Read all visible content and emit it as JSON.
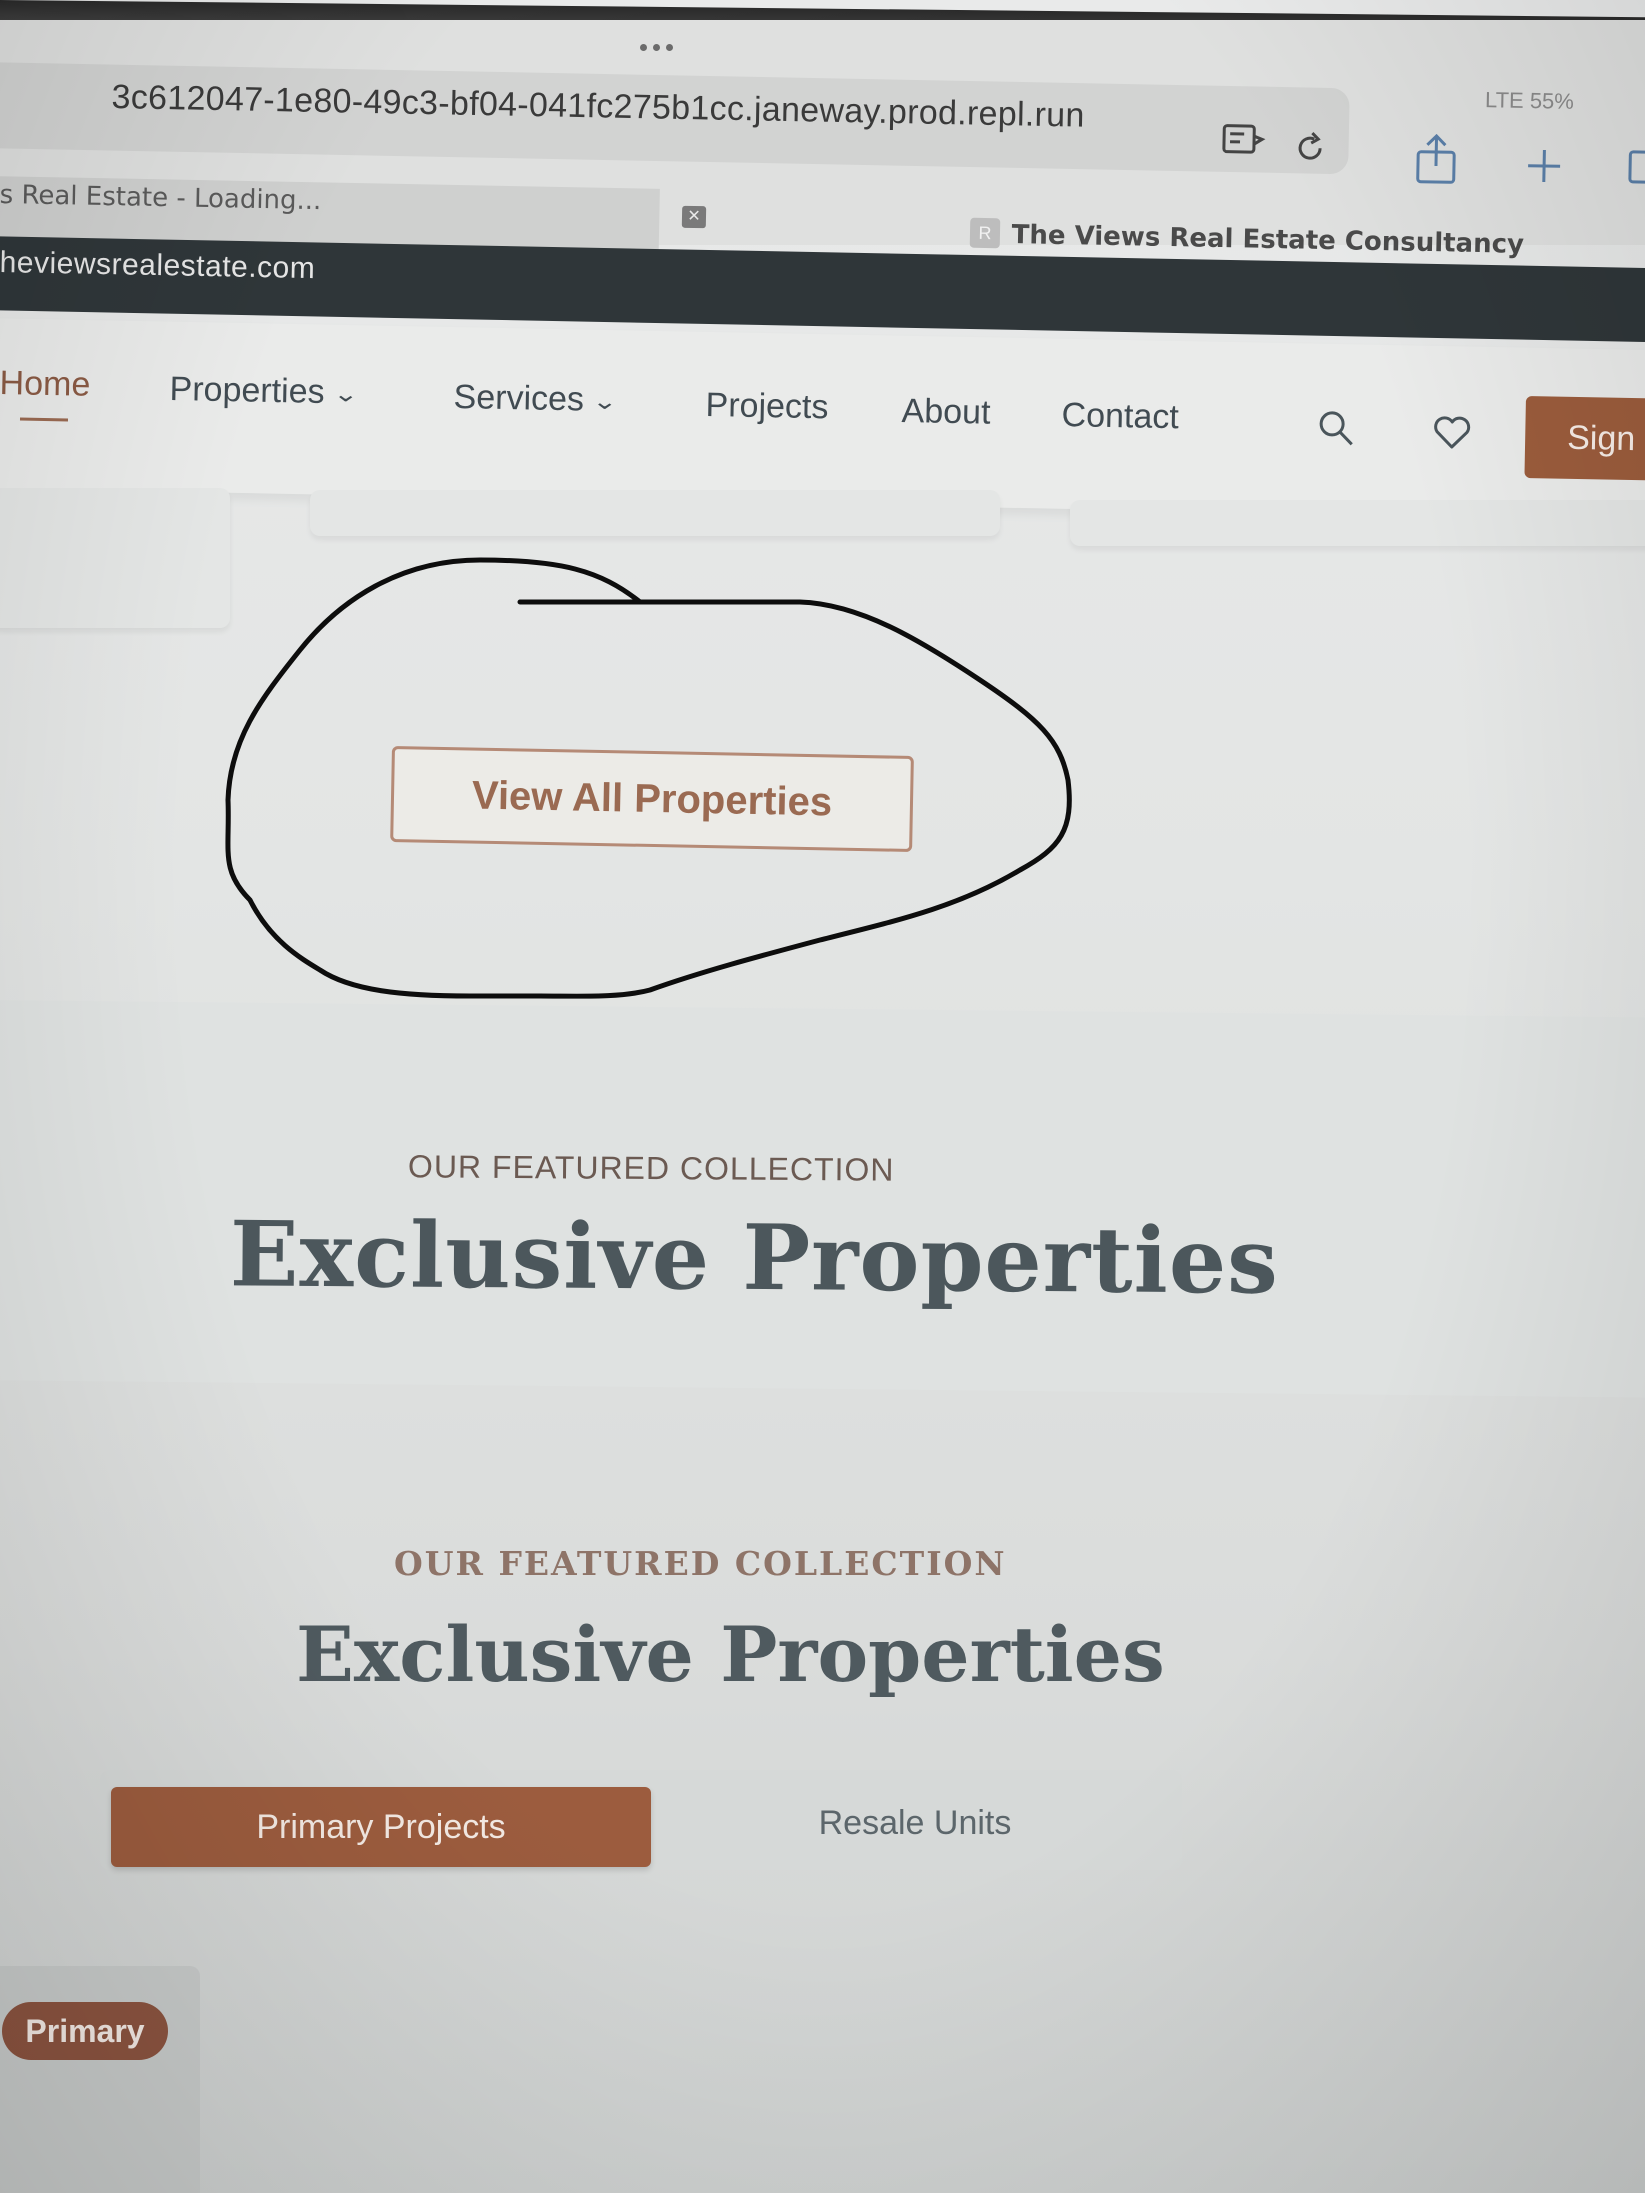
{
  "browser": {
    "url": "3c612047-1e80-49c3-bf04-041fc275b1cc.janeway.prod.repl.run",
    "status": "LTE 55%",
    "tabs": [
      {
        "label": "s Real Estate - Loading..."
      },
      {
        "label": "The Views Real Estate Consultancy"
      }
    ],
    "site_strip": "heviewsrealestate.com"
  },
  "nav": {
    "items": [
      {
        "label": "Home"
      },
      {
        "label": "Properties"
      },
      {
        "label": "Services"
      },
      {
        "label": "Projects"
      },
      {
        "label": "About"
      },
      {
        "label": "Contact"
      }
    ],
    "signin_label": "Sign"
  },
  "cta": {
    "view_all_label": "View All Properties"
  },
  "section_1": {
    "eyebrow": "OUR FEATURED COLLECTION",
    "heading": "Exclusive Properties"
  },
  "section_2": {
    "eyebrow": "OUR FEATURED COLLECTION",
    "heading": "Exclusive Properties",
    "toggle": {
      "primary_label": "Primary Projects",
      "resale_label": "Resale Units"
    }
  },
  "card": {
    "badge": "Primary"
  },
  "colors": {
    "accent": "#9b5c3c",
    "heading": "#4c575c",
    "site_strip": "#2f3639"
  }
}
